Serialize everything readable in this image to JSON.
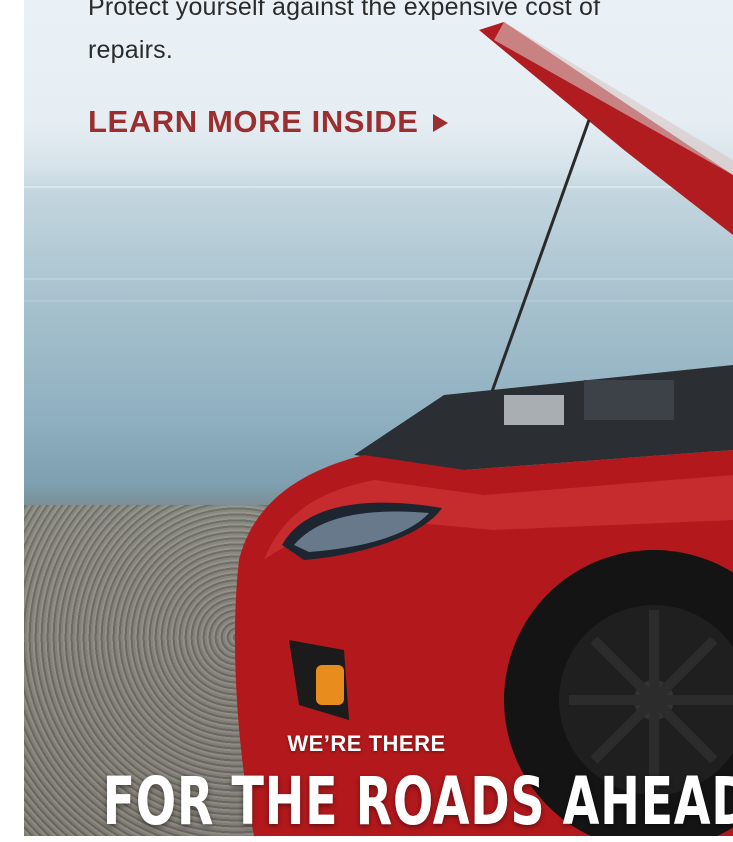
{
  "hero": {
    "body_text": "Protect yourself against the expensive cost of repairs.",
    "cta_label": "LEARN MORE INSIDE",
    "cta_icon": "play-triangle-icon",
    "kicker": "WE’RE THERE",
    "headline": "FOR THE ROADS AHEAD"
  },
  "colors": {
    "cta": "#9b2f2f",
    "body_text": "#2b2b2b",
    "overlay_text": "#ffffff",
    "car_body": "#b3191c"
  }
}
